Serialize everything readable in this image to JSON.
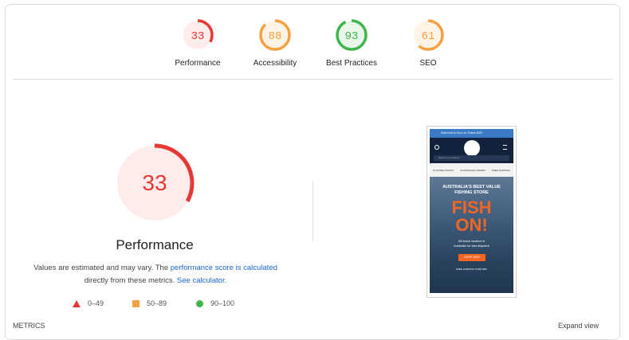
{
  "scores": [
    {
      "label": "Performance",
      "value": 33,
      "fraction": 0.33,
      "status": "fail"
    },
    {
      "label": "Accessibility",
      "value": 88,
      "fraction": 0.88,
      "status": "average"
    },
    {
      "label": "Best Practices",
      "value": 93,
      "fraction": 0.93,
      "status": "pass"
    },
    {
      "label": "SEO",
      "value": 61,
      "fraction": 0.61,
      "status": "average"
    }
  ],
  "colors": {
    "fail": "#e53935",
    "fail_bg": "#fdecea",
    "average": "#f5a142",
    "average_bg": "#fff3e6",
    "pass": "#3fb54c",
    "pass_bg": "#e9f6ea"
  },
  "main": {
    "score": "33",
    "title": "Performance",
    "desc_before": "Values are estimated and may vary. The ",
    "link_score": "performance score is calculated",
    "desc_middle": " directly from these metrics. ",
    "link_calc": "See calculator",
    "desc_after": "."
  },
  "legend": [
    {
      "shape": "triangle",
      "range": "0–49"
    },
    {
      "shape": "square",
      "range": "50–89"
    },
    {
      "shape": "circle",
      "range": "90–100"
    }
  ],
  "screenshot": {
    "announcement": "Delivered to Door on Orders $49+",
    "search_placeholder": "Search for products",
    "info": [
      "IN-STORE PICKUP",
      "AUSTRALIAN OWNED",
      "FREE SHIPPING"
    ],
    "hero_line1": "AUSTRALIA'S BEST VALUE",
    "hero_line2": "FISHING STORE",
    "hero_big1": "FISH",
    "hero_big2": "ON!",
    "hero_sub1": "All stock located in",
    "hero_sub2": "Australia for fast dispatch",
    "button": "SHOP NOW",
    "shipping": "FREE SHIPPING OVER $49*"
  },
  "footer_cut": {
    "left": "METRICS",
    "right": "Expand view"
  }
}
